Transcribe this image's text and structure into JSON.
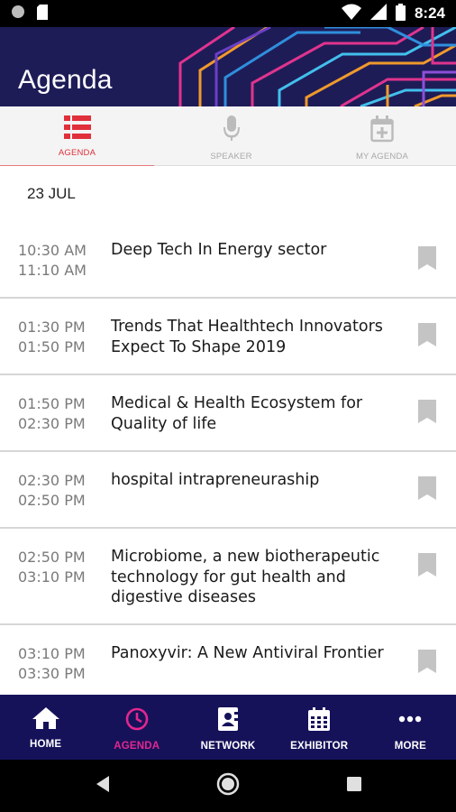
{
  "status_bar": {
    "time": "8:24",
    "icons": [
      "notification-dot-icon",
      "sim-card-icon",
      "wifi-icon",
      "cellular-signal-icon",
      "battery-icon"
    ]
  },
  "header": {
    "title": "Agenda"
  },
  "tabs": [
    {
      "label": "AGENDA",
      "icon": "list-icon",
      "active": true
    },
    {
      "label": "SPEAKER",
      "icon": "microphone-icon",
      "active": false
    },
    {
      "label": "MY AGENDA",
      "icon": "calendar-add-icon",
      "active": false
    }
  ],
  "agenda": {
    "date": "23 JUL",
    "sessions": [
      {
        "start": "10:30 AM",
        "end": "11:10 AM",
        "title": "Deep Tech In Energy sector"
      },
      {
        "start": "01:30 PM",
        "end": "01:50 PM",
        "title": "Trends That Healthtech Innovators Expect To Shape 2019"
      },
      {
        "start": "01:50 PM",
        "end": "02:30 PM",
        "title": "Medical & Health Ecosystem for Quality of life"
      },
      {
        "start": "02:30 PM",
        "end": "02:50 PM",
        "title": "hospital intrapreneuraship"
      },
      {
        "start": "02:50 PM",
        "end": "03:10 PM",
        "title": "Microbiome, a new biotherapeutic technology for gut health and digestive diseases"
      },
      {
        "start": "03:10 PM",
        "end": "03:30 PM",
        "title": "Panoxyvir: A New Antiviral Frontier"
      }
    ]
  },
  "bottom_nav": [
    {
      "label": "HOME",
      "icon": "home-icon",
      "active": false
    },
    {
      "label": "AGENDA",
      "icon": "clock-icon",
      "active": true
    },
    {
      "label": "NETWORK",
      "icon": "contact-card-icon",
      "active": false
    },
    {
      "label": "EXHIBITOR",
      "icon": "calendar-grid-icon",
      "active": false
    },
    {
      "label": "MORE",
      "icon": "more-dots-icon",
      "active": false
    }
  ],
  "colors": {
    "header_bg": "#1e1c57",
    "accent_red": "#e0303b",
    "nav_bg": "#16125a",
    "nav_active": "#e2278f"
  }
}
